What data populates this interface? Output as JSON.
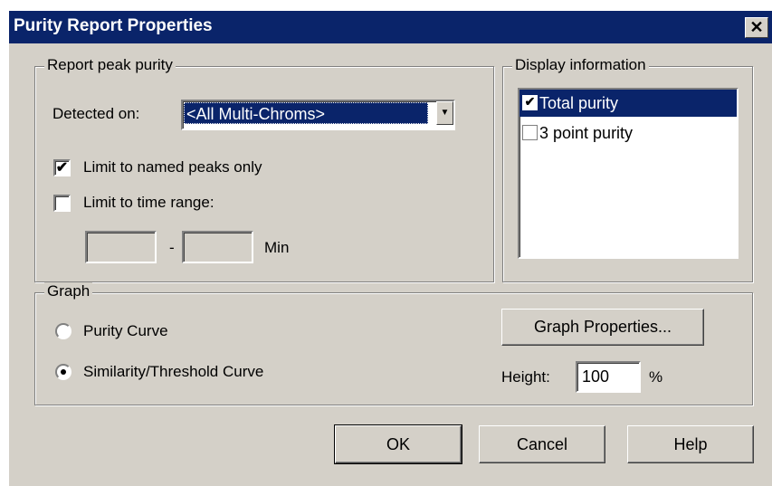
{
  "dialog": {
    "title": "Purity Report Properties",
    "close_glyph": "✕"
  },
  "report_peak_purity": {
    "legend": "Report peak purity",
    "detected_on_label": "Detected on:",
    "detected_on_value": "<All Multi-Chroms>",
    "limit_named_label": "Limit to named peaks only",
    "limit_named_checked": true,
    "limit_time_label": "Limit to time range:",
    "limit_time_checked": false,
    "range_from": "",
    "range_to": "",
    "range_dash": "-",
    "range_unit": "Min"
  },
  "display_information": {
    "legend": "Display information",
    "items": [
      {
        "label": "Total purity",
        "checked": true,
        "selected": true
      },
      {
        "label": "3 point purity",
        "checked": false,
        "selected": false
      }
    ]
  },
  "graph": {
    "legend": "Graph",
    "purity_curve_label": "Purity Curve",
    "similarity_curve_label": "Similarity/Threshold Curve",
    "selected_curve": "Similarity/Threshold Curve",
    "properties_button": "Graph Properties...",
    "height_label": "Height:",
    "height_value": "100",
    "height_unit": "%"
  },
  "buttons": {
    "ok": "OK",
    "cancel": "Cancel",
    "help": "Help"
  },
  "colors": {
    "face": "#d4d0c8",
    "title_bar": "#0a246a",
    "selection": "#0a246a"
  }
}
